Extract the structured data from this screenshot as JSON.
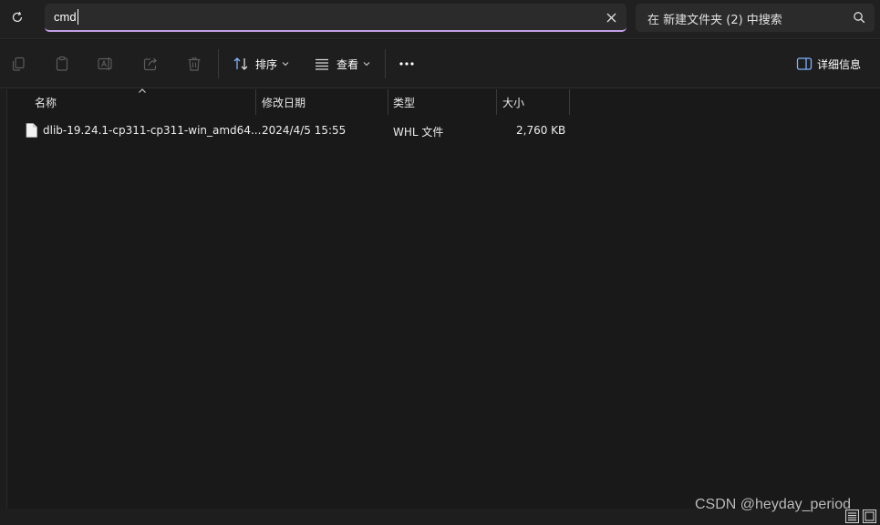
{
  "address_bar": {
    "path_value": "cmd",
    "search_placeholder": "在 新建文件夹 (2) 中搜索"
  },
  "toolbar": {
    "icons": [
      "copy-icon",
      "paste-icon",
      "rename-icon",
      "share-icon",
      "delete-icon"
    ],
    "sort_label": "排序",
    "view_label": "查看",
    "more_label": "···",
    "details_label": "详细信息"
  },
  "columns": [
    {
      "label": "名称"
    },
    {
      "label": "修改日期"
    },
    {
      "label": "类型"
    },
    {
      "label": "大小"
    }
  ],
  "files": [
    {
      "name": "dlib-19.24.1-cp311-cp311-win_amd64...",
      "modified": "2024/4/5 15:55",
      "type": "WHL 文件",
      "size": "2,760 KB"
    }
  ],
  "watermark": "CSDN @heyday_period",
  "colors": {
    "background": "#191919",
    "accent_underline": "#c59fe6",
    "sort_icon_blue": "#7fb3ff",
    "text": "#e6e6e6"
  }
}
